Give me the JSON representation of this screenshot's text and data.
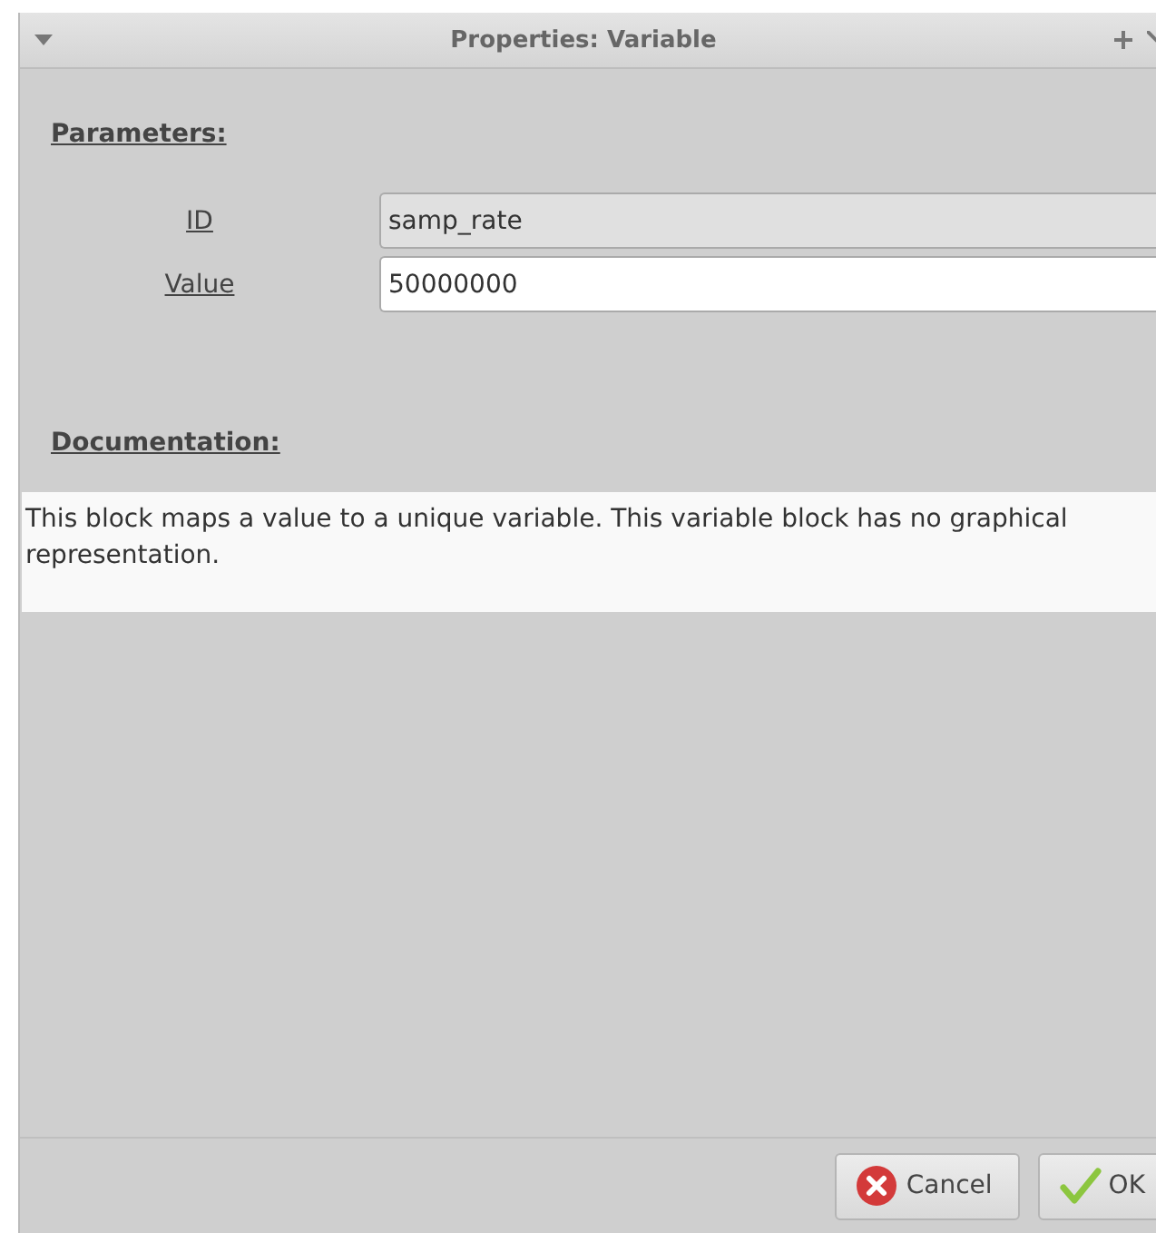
{
  "window": {
    "title": "Properties: Variable"
  },
  "parameters": {
    "heading": "Parameters:",
    "fields": [
      {
        "label": "ID",
        "value": "samp_rate",
        "editable": false
      },
      {
        "label": "Value",
        "value": "50000000",
        "editable": true
      }
    ]
  },
  "documentation": {
    "heading": "Documentation:",
    "text": "This block maps a value to a unique variable. This variable block has no graphical representation."
  },
  "buttons": [
    {
      "kind": "cancel",
      "label": "Cancel"
    },
    {
      "kind": "ok",
      "label": "OK"
    }
  ]
}
